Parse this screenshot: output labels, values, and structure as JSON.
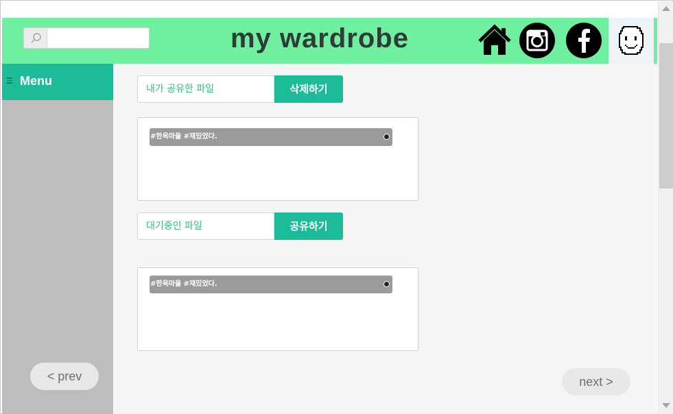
{
  "header": {
    "title": "my wardrobe",
    "search": {
      "placeholder": "",
      "value": ""
    },
    "icons": [
      "home-icon",
      "instagram-icon",
      "facebook-icon",
      "profile-face-icon"
    ],
    "accent_color": "#6ef0a0"
  },
  "sidebar": {
    "menu_label": "Menu",
    "prev_label": "< prev",
    "accent_color": "#1cbc9a"
  },
  "main": {
    "shared": {
      "field_label": "내가 공유한 파일",
      "button_label": "삭제하기",
      "files": [
        {
          "name": "#한옥마을 #재밌었다."
        }
      ]
    },
    "pending": {
      "field_label": "대기중인 파일",
      "button_label": "공유하기",
      "files": [
        {
          "name": "#한옥마을 #재밌었다."
        }
      ]
    },
    "next_label": "next >"
  }
}
